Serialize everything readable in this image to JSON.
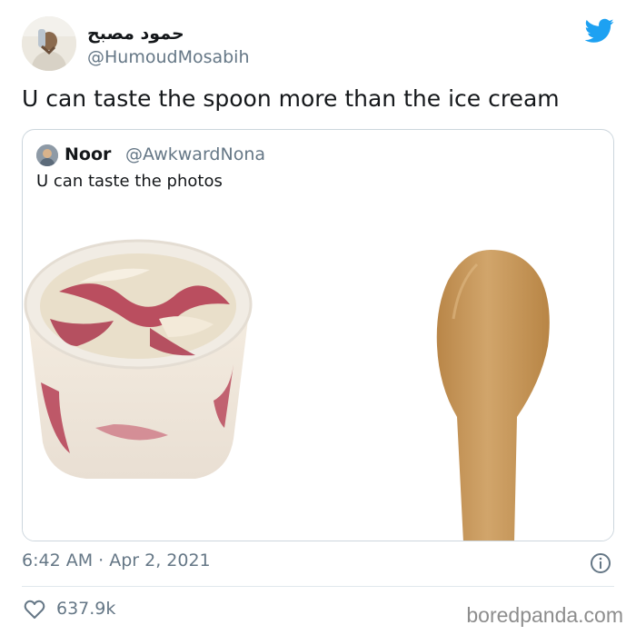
{
  "tweet": {
    "display_name": "حمود مصبح",
    "handle": "@HumoudMosabih",
    "text": "U can taste the spoon more than the ice cream",
    "timestamp": "6:42 AM · Apr 2, 2021",
    "like_count": "637.9k",
    "icons": [
      "twitter-bird-icon",
      "info-icon",
      "heart-icon"
    ]
  },
  "quoted_tweet": {
    "display_name": "Noor",
    "handle": "@AwkwardNona",
    "text": "U can taste the photos",
    "media": [
      "ice-cream-cup-image",
      "wooden-spoon-image"
    ]
  },
  "watermark": "boredpanda.com",
  "colors": {
    "twitter_blue": "#1da1f2",
    "secondary_text": "#657786",
    "border": "#ccd6dd",
    "spoon_wood": "#c99a5b",
    "ice_cream": "#efe5d2",
    "raspberry": "#b2354c"
  }
}
